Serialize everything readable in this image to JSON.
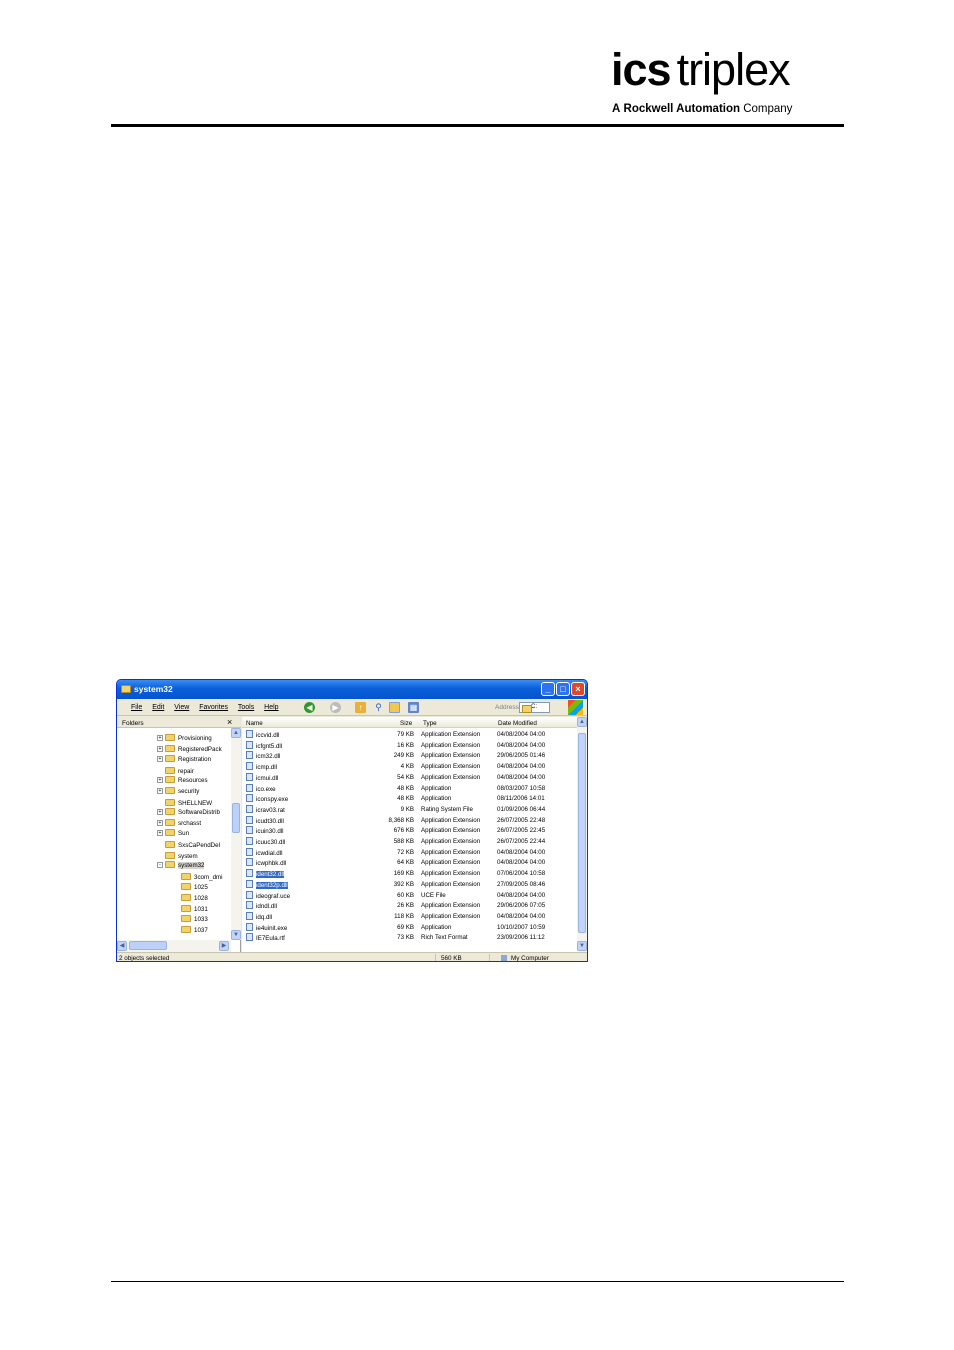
{
  "header": {
    "logo_ics": "ics",
    "logo_triplex": "triplex",
    "tagline_prefix": "A",
    "tagline_brand": "Rockwell Automation",
    "tagline_suffix": "Company"
  },
  "window": {
    "title": "system32",
    "menu": [
      "File",
      "Edit",
      "View",
      "Favorites",
      "Tools",
      "Help"
    ],
    "address_label": "Address",
    "address_value": "C:",
    "folders_title": "Folders",
    "close_symbol": "×",
    "tree": [
      {
        "label": "Provisioning",
        "expander": "+",
        "indent": 0
      },
      {
        "label": "RegisteredPack",
        "expander": "+",
        "indent": 0
      },
      {
        "label": "Registration",
        "expander": "+",
        "indent": 0
      },
      {
        "label": "repair",
        "expander": "",
        "indent": 0
      },
      {
        "label": "Resources",
        "expander": "+",
        "indent": 0
      },
      {
        "label": "security",
        "expander": "+",
        "indent": 0
      },
      {
        "label": "SHELLNEW",
        "expander": "",
        "indent": 0
      },
      {
        "label": "SoftwareDistrib",
        "expander": "+",
        "indent": 0
      },
      {
        "label": "srchasst",
        "expander": "+",
        "indent": 0
      },
      {
        "label": "Sun",
        "expander": "+",
        "indent": 0
      },
      {
        "label": "SxsCaPendDel",
        "expander": "",
        "indent": 0
      },
      {
        "label": "system",
        "expander": "",
        "indent": 0
      },
      {
        "label": "system32",
        "expander": "-",
        "indent": 0,
        "selected": true
      },
      {
        "label": "3com_dmi",
        "expander": "",
        "indent": 1
      },
      {
        "label": "1025",
        "expander": "",
        "indent": 1
      },
      {
        "label": "1028",
        "expander": "",
        "indent": 1
      },
      {
        "label": "1031",
        "expander": "",
        "indent": 1
      },
      {
        "label": "1033",
        "expander": "",
        "indent": 1
      },
      {
        "label": "1037",
        "expander": "",
        "indent": 1
      }
    ],
    "columns": {
      "name": "Name",
      "size": "Size",
      "type": "Type",
      "date": "Date Modified"
    },
    "files": [
      {
        "name": "iccvid.dll",
        "size": "79 KB",
        "type": "Application Extension",
        "date": "04/08/2004 04:00"
      },
      {
        "name": "icfgnt5.dll",
        "size": "16 KB",
        "type": "Application Extension",
        "date": "04/08/2004 04:00"
      },
      {
        "name": "icm32.dll",
        "size": "249 KB",
        "type": "Application Extension",
        "date": "29/06/2005 01:46"
      },
      {
        "name": "icmp.dll",
        "size": "4 KB",
        "type": "Application Extension",
        "date": "04/08/2004 04:00"
      },
      {
        "name": "icmui.dll",
        "size": "54 KB",
        "type": "Application Extension",
        "date": "04/08/2004 04:00"
      },
      {
        "name": "ico.exe",
        "size": "48 KB",
        "type": "Application",
        "date": "08/03/2007 10:58"
      },
      {
        "name": "iconspy.exe",
        "size": "48 KB",
        "type": "Application",
        "date": "08/11/2006 14:01"
      },
      {
        "name": "icrav03.rat",
        "size": "9 KB",
        "type": "Rating System File",
        "date": "01/09/2006 06:44"
      },
      {
        "name": "icudt30.dll",
        "size": "8,368 KB",
        "type": "Application Extension",
        "date": "26/07/2005 22:48"
      },
      {
        "name": "icuin30.dll",
        "size": "676 KB",
        "type": "Application Extension",
        "date": "26/07/2005 22:45"
      },
      {
        "name": "icuuc30.dll",
        "size": "588 KB",
        "type": "Application Extension",
        "date": "26/07/2005 22:44"
      },
      {
        "name": "icwdial.dll",
        "size": "72 KB",
        "type": "Application Extension",
        "date": "04/08/2004 04:00"
      },
      {
        "name": "icwphbk.dll",
        "size": "64 KB",
        "type": "Application Extension",
        "date": "04/08/2004 04:00"
      },
      {
        "name": "ident32.dll",
        "size": "169 KB",
        "type": "Application Extension",
        "date": "07/06/2004 10:58",
        "selected": true
      },
      {
        "name": "ident32p.dll",
        "size": "392 KB",
        "type": "Application Extension",
        "date": "27/09/2005 08:46",
        "selected": true
      },
      {
        "name": "ideograf.uce",
        "size": "60 KB",
        "type": "UCE File",
        "date": "04/08/2004 04:00"
      },
      {
        "name": "idndl.dll",
        "size": "26 KB",
        "type": "Application Extension",
        "date": "29/06/2006 07:05"
      },
      {
        "name": "idq.dll",
        "size": "118 KB",
        "type": "Application Extension",
        "date": "04/08/2004 04:00"
      },
      {
        "name": "ie4uinit.exe",
        "size": "69 KB",
        "type": "Application",
        "date": "10/10/2007 10:59"
      },
      {
        "name": "IE7Eula.rtf",
        "size": "73 KB",
        "type": "Rich Text Format",
        "date": "23/09/2006 11:12"
      }
    ],
    "status": {
      "selection": "2 objects selected",
      "size": "560 KB",
      "zone": "My Computer"
    }
  }
}
